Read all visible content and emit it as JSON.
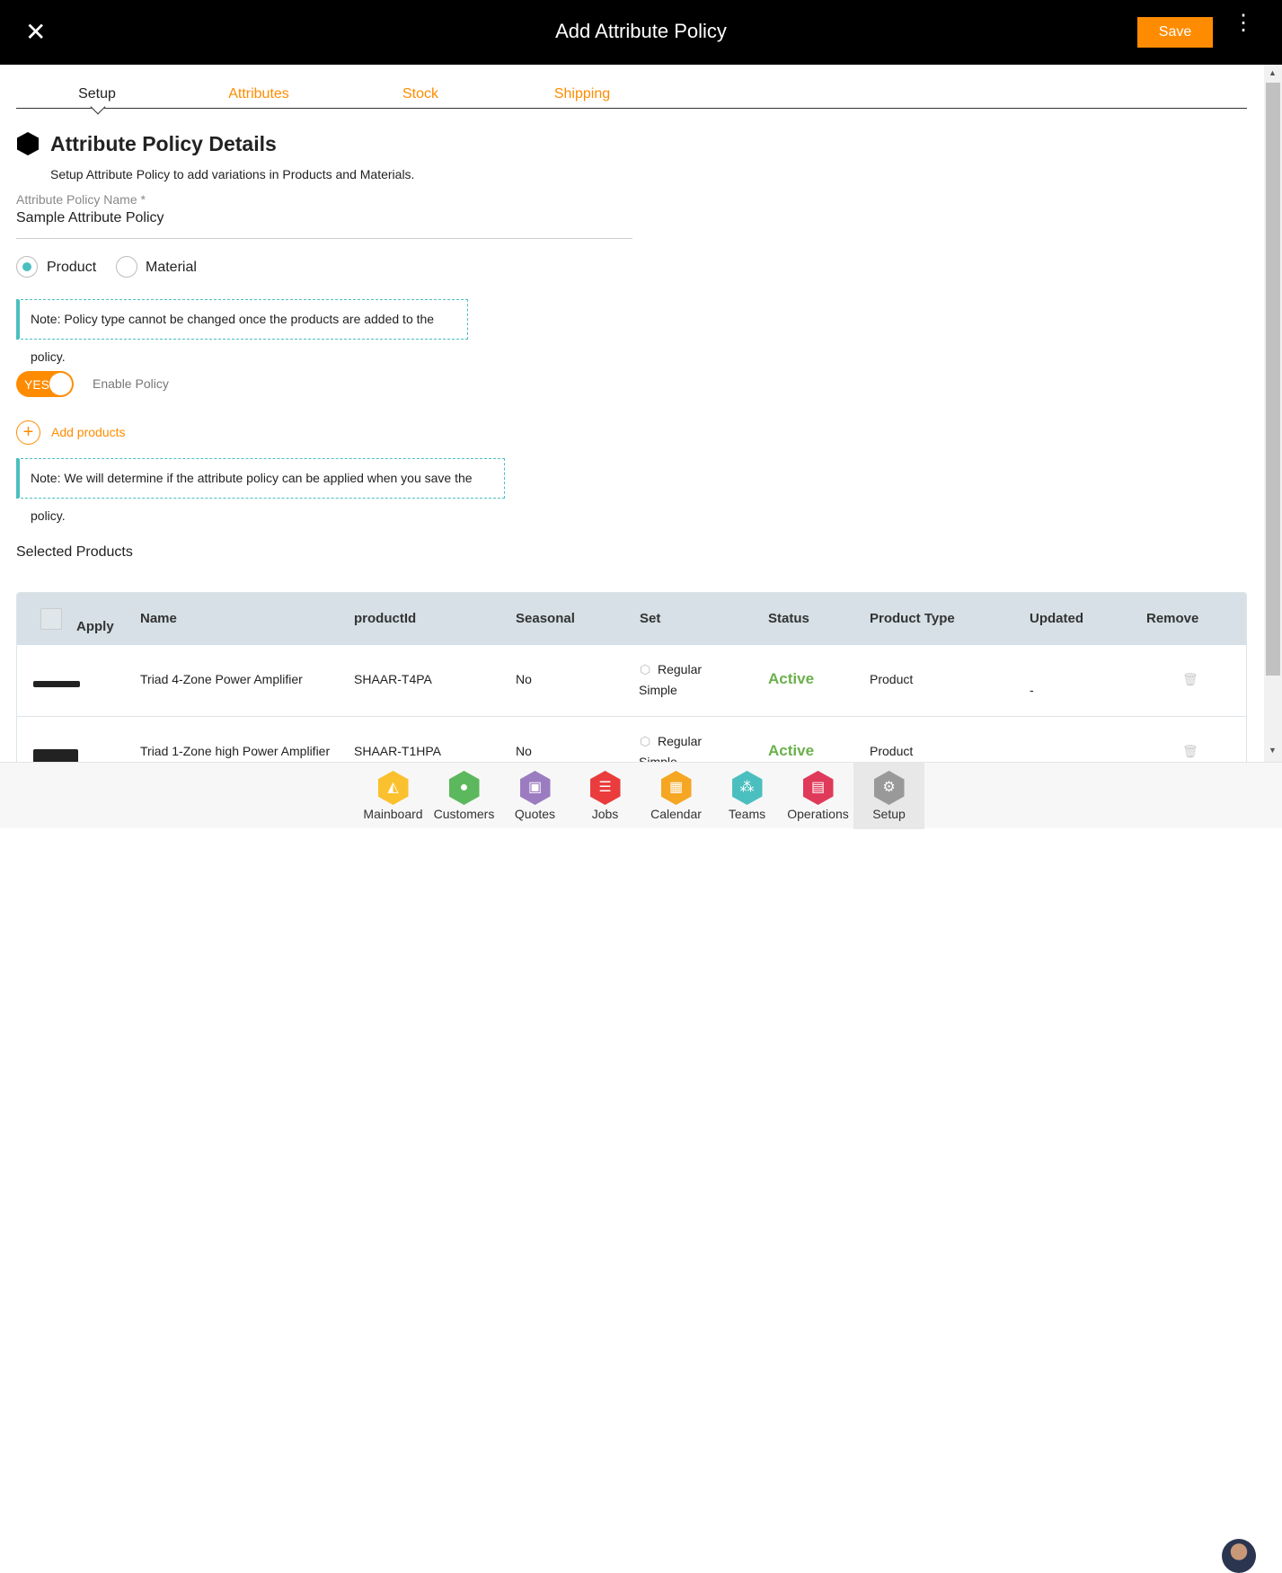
{
  "header": {
    "title": "Add Attribute Policy",
    "save_label": "Save"
  },
  "tabs": [
    {
      "label": "Setup",
      "active": true
    },
    {
      "label": "Attributes"
    },
    {
      "label": "Stock"
    },
    {
      "label": "Shipping"
    }
  ],
  "section": {
    "title": "Attribute Policy Details",
    "subtitle": "Setup Attribute Policy to add variations in Products and Materials."
  },
  "form": {
    "name_label": "Attribute Policy Name *",
    "name_value": "Sample Attribute Policy",
    "type_options": [
      {
        "label": "Product",
        "selected": true
      },
      {
        "label": "Material",
        "selected": false
      }
    ],
    "note1": "Note: Policy type cannot be changed once the products are added to the policy.",
    "toggle_label": "YES",
    "toggle_on": true,
    "enable_label": "Enable Policy",
    "add_products": "Add products",
    "note2": "Note: We will determine if the attribute policy can be applied when you save the policy."
  },
  "selected_title": "Selected Products",
  "table": {
    "headers": [
      "Apply",
      "Name",
      "productId",
      "Seasonal",
      "Set",
      "Status",
      "Product Type",
      "Updated",
      "Remove"
    ],
    "rows": [
      {
        "name": "Triad 4-Zone Power Amplifier",
        "productId": "SHAAR-T4PA",
        "seasonal": "No",
        "set1": "Regular",
        "set2": "Simple",
        "status": "Active",
        "type": "Product",
        "updated": "-"
      },
      {
        "name": "Triad 1-Zone high Power Amplifier",
        "productId": "SHAAR-T1HPA",
        "seasonal": "No",
        "set1": "Regular",
        "set2": "Simple",
        "status": "Active",
        "type": "Product",
        "updated": "-"
      }
    ]
  },
  "nav": [
    {
      "label": "Mainboard",
      "color": "#fbc02d"
    },
    {
      "label": "Customers",
      "color": "#5cb85c"
    },
    {
      "label": "Quotes",
      "color": "#9b7cc0"
    },
    {
      "label": "Jobs",
      "color": "#ea3c3c"
    },
    {
      "label": "Calendar",
      "color": "#f5a623"
    },
    {
      "label": "Teams",
      "color": "#4bbfc0"
    },
    {
      "label": "Operations",
      "color": "#e03a5a"
    },
    {
      "label": "Setup",
      "color": "#999999",
      "active": true
    }
  ],
  "accent": "#ff8c00"
}
